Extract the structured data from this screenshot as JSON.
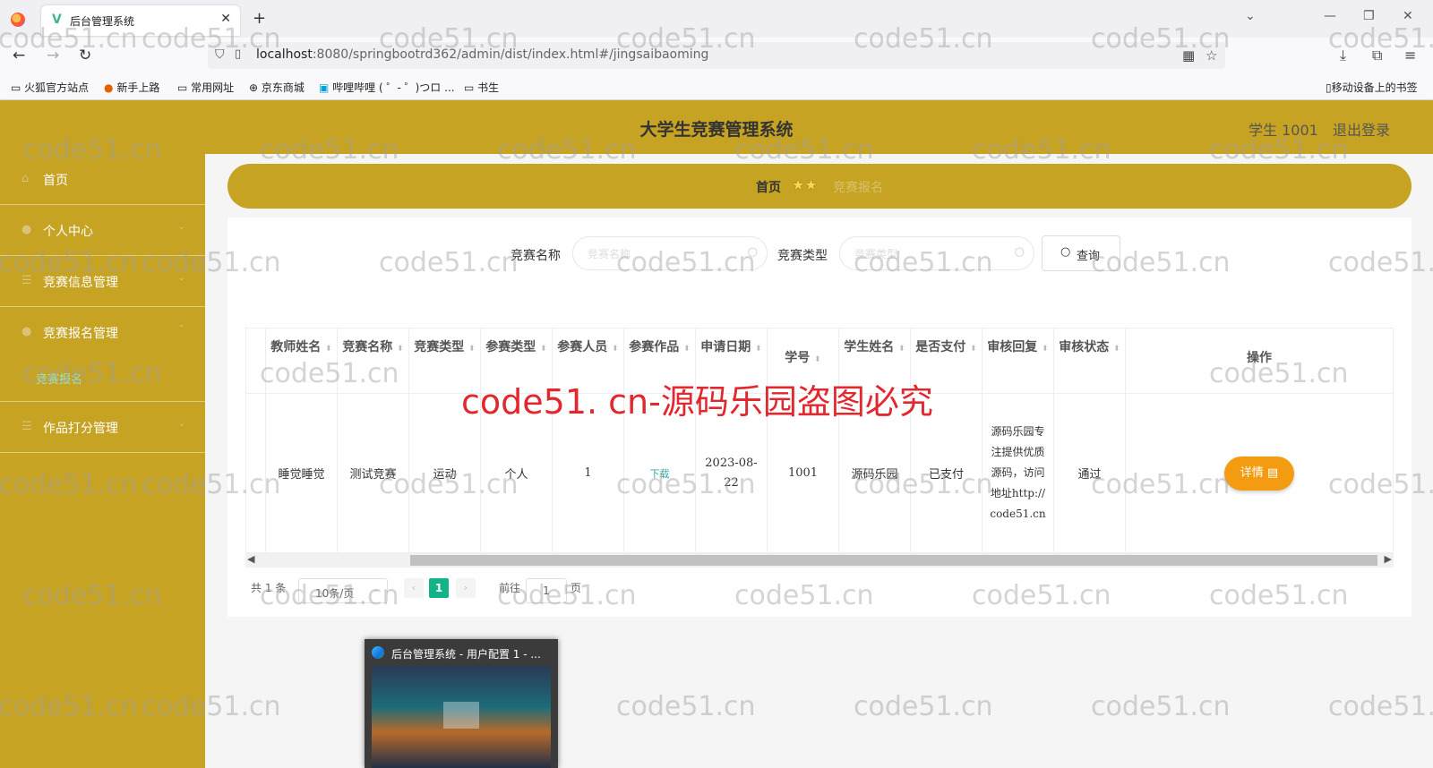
{
  "browser": {
    "tab_title": "后台管理系统",
    "url_host": "localhost",
    "url_rest": ":8080/springbootrd362/admin/dist/index.html#/jingsaibaoming",
    "bookmarks": [
      "火狐官方站点",
      "新手上路",
      "常用网址",
      "京东商城",
      "哔哩哔哩 ( ゜- ゜)つロ ...",
      "书生"
    ],
    "mobile_bookmarks": "移动设备上的书签"
  },
  "header": {
    "title": "大学生竞赛管理系统",
    "user": "学生 1001",
    "logout": "退出登录"
  },
  "sidebar": {
    "items": [
      {
        "label": "首页",
        "icon": "home-icon"
      },
      {
        "label": "个人中心",
        "icon": "user-icon"
      },
      {
        "label": "竞赛信息管理",
        "icon": "list-icon"
      },
      {
        "label": "竞赛报名管理",
        "icon": "list-icon"
      },
      {
        "label": "作品打分管理",
        "icon": "list-icon"
      }
    ],
    "sub_item": "竞赛报名"
  },
  "breadcrumb": {
    "home": "首页",
    "current": "竞赛报名"
  },
  "search": {
    "name_label": "竞赛名称",
    "name_placeholder": "竞赛名称",
    "type_label": "竞赛类型",
    "type_placeholder": "竞赛类型",
    "query_button": "查询"
  },
  "table": {
    "headers": [
      "教师姓名",
      "竞赛名称",
      "竞赛类型",
      "参赛类型",
      "参赛人员",
      "参赛作品",
      "申请日期",
      "学号",
      "学生姓名",
      "是否支付",
      "审核回复",
      "审核状态",
      "操作"
    ],
    "rows": [
      {
        "teacher": "睡觉睡觉",
        "contest": "测试竞赛",
        "contest_type": "运动",
        "entry_type": "个人",
        "members": "1",
        "work": "下载",
        "date": "2023-08-22",
        "student_no": "1001",
        "student_name": "源码乐园",
        "paid": "已支付",
        "reply": "源码乐园专注提供优质源码，访问地址http://code51.cn",
        "status": "通过",
        "action": "详情"
      }
    ]
  },
  "pagination": {
    "total": "共 1 条",
    "page_size": "10条/页",
    "current_page": "1",
    "goto_prefix": "前往",
    "goto_value": "1",
    "goto_suffix": "页"
  },
  "taskbar_preview": {
    "title": "后台管理系统 - 用户配置 1 - ..."
  },
  "watermark": {
    "text": "code51.cn",
    "big_text": "code51. cn-源码乐园盗图必究"
  },
  "colors": {
    "theme": "#c6a323",
    "accent_green": "#13b38a",
    "detail_orange": "#f39c12",
    "watermark_red": "#e0282e"
  }
}
